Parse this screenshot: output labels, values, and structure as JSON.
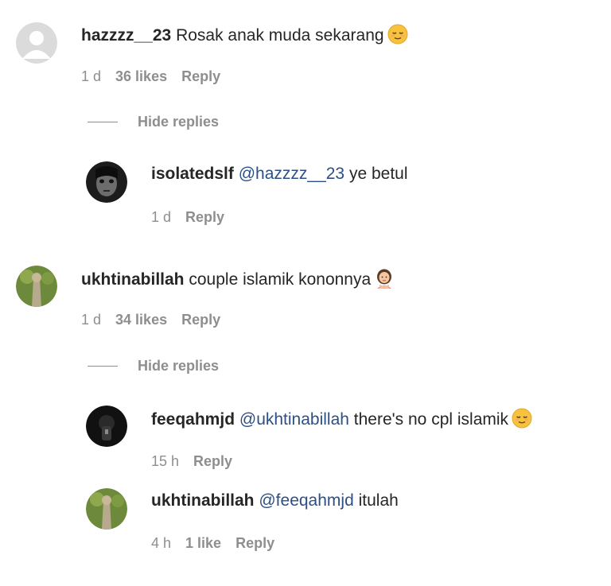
{
  "comments": [
    {
      "username": "hazzzz__23",
      "text": "Rosak anak muda sekarang",
      "emoji": "relieved-face",
      "time": "1 d",
      "likes": "36 likes",
      "reply": "Reply",
      "hide_replies": "Hide replies",
      "replies": [
        {
          "username": "isolatedslf",
          "mention": "@hazzzz__23",
          "text": "ye betul",
          "time": "1 d",
          "reply": "Reply"
        }
      ]
    },
    {
      "username": "ukhtinabillah",
      "text": "couple islamik kononnya",
      "emoji": "woman-gesturing-no",
      "time": "1 d",
      "likes": "34 likes",
      "reply": "Reply",
      "hide_replies": "Hide replies",
      "replies": [
        {
          "username": "feeqahmjd",
          "mention": "@ukhtinabillah",
          "text": "there's no cpl islamik",
          "emoji": "relieved-face",
          "time": "15 h",
          "reply": "Reply"
        },
        {
          "username": "ukhtinabillah",
          "mention": "@feeqahmjd",
          "text": "itulah",
          "time": "4 h",
          "likes": "1 like",
          "reply": "Reply"
        }
      ]
    }
  ],
  "colors": {
    "text": "#262626",
    "meta": "#8e8e8e",
    "mention": "#2d4f85",
    "background": "#ffffff"
  }
}
